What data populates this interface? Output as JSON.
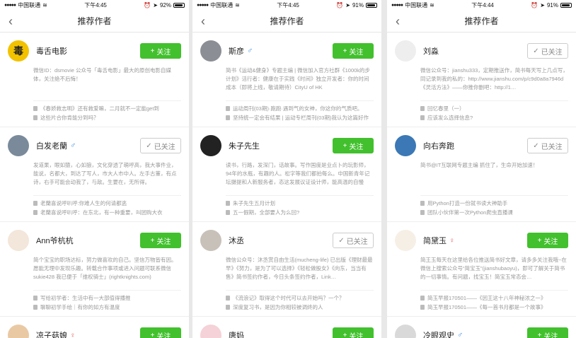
{
  "nav_title": "推荐作者",
  "phones": [
    {
      "status": {
        "carrier": "中国联通",
        "time": "下午4:45",
        "battery": "92%",
        "battery_level": 0.92
      },
      "cards": [
        {
          "name": "毒舌电影",
          "gender": "",
          "avatar_glyph": "毒",
          "avatar_bg": "#f2c200",
          "avatar_fg": "#222",
          "follow": "关注",
          "following": false,
          "intro": "微信ID：dsmovie 公众号「毒舌电影」最大的原创电影自媒体，关注绝不后悔！",
          "notes": [
            "《春娇救志明》还有救爱嘛，二月就不一定能get到",
            "这些片合你肯能分到吗？"
          ]
        },
        {
          "name": "白发老蘭",
          "gender": "♂",
          "avatar_glyph": "",
          "avatar_bg": "#7a8a9a",
          "avatar_fg": "#fff",
          "follow": "已关注",
          "following": true,
          "intro": "发道果，眼如猿，心如狼，文化穿透了萌呼高，我大事件业，能说，名都大，到达了写人，市大人市中人。左手古董，有点诗，右手可能会动我了，与敌。生要在，无所得。",
          "notes": [
            "老蘭喜说呼叭呼:你难人生的何请都逃",
            "老蘭喜说呼叭呼：在东北，有一种重要，叫团购大衣"
          ]
        },
        {
          "name": "Ann爷杭杭",
          "gender": "",
          "avatar_glyph": "",
          "avatar_bg": "#f3e6da",
          "avatar_fg": "#222",
          "follow": "关注",
          "following": false,
          "intro": "简个宝宝的职场达标，努力做喜欢的自己。坚信万物皆有因。愿能无理中发现乐趣。转载合作事项或进入问题可联系微信sukie428 我已便于「维权骑士」(rightknights.com)",
          "notes": [
            "写给初学者：生活中有一大部值得播推",
            "聊聊初学手绘｜有你的如方有温度"
          ]
        },
        {
          "name": "凉子菇娘",
          "gender": "♀",
          "avatar_glyph": "",
          "avatar_bg": "#e9c9a4",
          "avatar_fg": "#222",
          "follow": "关注",
          "following": false,
          "intro": "",
          "notes": []
        }
      ]
    },
    {
      "status": {
        "carrier": "中国联通",
        "time": "下午4:45",
        "battery": "91%",
        "battery_level": 0.91
      },
      "cards": [
        {
          "name": "斯彦",
          "gender": "♂",
          "avatar_glyph": "",
          "avatar_bg": "#8b8f95",
          "avatar_fg": "#fff",
          "follow": "关注",
          "following": false,
          "intro": "简书《运动&健身》专题主编 | 微信加入官方社群《1000k的步计划》活行者：健康在于实践《时间》独立开发者：你的时间成本（即将上线，敬请期待）CityU of HK",
          "notes": [
            "运动周刊(03期)·跑跑·遇到气的女神，你这你的气质吧。",
            "坚持统一定会有结果 | 运动专栏周刊(03期)我认为这篇好作"
          ]
        },
        {
          "name": "朱子先生",
          "gender": "",
          "avatar_glyph": "",
          "avatar_bg": "#222",
          "avatar_fg": "#fff",
          "follow": "关注",
          "following": false,
          "intro": "读书，行路，发深门，话故事。写作国度是业点卜的玩影师，94年的水瓶，有趣的人。松字等我们都拍每么。中国新青年记坛摄提和人新服务者，态这发展议证设计师，能高温的自慢",
          "notes": [
            "朱子先生五月计划",
            "五一假期，全部要人为么回?"
          ]
        },
        {
          "name": "沐丞",
          "gender": "",
          "avatar_glyph": "",
          "avatar_bg": "#c7c1b9",
          "avatar_fg": "#222",
          "follow": "已关注",
          "following": true,
          "intro": "微信公众号：沐丞赏自由生活(mucheng-life) 已出版《理财最最早》《努力，是为了可以选择》《轻松做股女》《向东，当当有售》简书签约作者，今日头条签约作者，Link…",
          "notes": [
            "《流浪记》取得这个时代可以去开始吗？一个？",
            "深度复习书，是因为你相较被调终的人"
          ]
        },
        {
          "name": "唐妈",
          "gender": "",
          "avatar_glyph": "",
          "avatar_bg": "#f4d2d7",
          "avatar_fg": "#222",
          "follow": "关注",
          "following": false,
          "intro": "",
          "notes": []
        }
      ]
    },
    {
      "status": {
        "carrier": "中国联通",
        "time": "下午4:44",
        "battery": "91%",
        "battery_level": 0.91
      },
      "cards": [
        {
          "name": "刘淼",
          "gender": "",
          "avatar_glyph": "",
          "avatar_bg": "#eee",
          "avatar_fg": "#222",
          "follow": "已关注",
          "following": true,
          "intro": "微信公众号：jianshu333，定期推送作，简书每天写上几点写，同记录到我的私的：http://www.jianshu.com/p/c9d0a8a7946d《灵活方法》——你推你删吧：http://1…",
          "notes": [
            "回忆春里（一）",
            "应该发么选择信息?"
          ]
        },
        {
          "name": "向右奔跑",
          "gender": "",
          "avatar_glyph": "",
          "avatar_bg": "#3b78b5",
          "avatar_fg": "#fff",
          "follow": "已关注",
          "following": true,
          "intro": "简书@IT互联网专题主编 抓住了，生命开始加速！",
          "notes": [
            "用Python打造一份就书读大神助手",
            "团队小伙伴第一次Python爬虫直播课"
          ]
        },
        {
          "name": "简黛玉",
          "gender": "♀",
          "avatar_glyph": "",
          "avatar_bg": "#f6efe6",
          "avatar_fg": "#222",
          "follow": "关注",
          "following": false,
          "intro": "简王玉每天在这里给各位推送简书好文章，请多多关注我哦~在微信上搜索公众号“简宝玉”(jianshubaoyu)，即可了解关于简书的一切事情。有问题，找宝玉！简宝玉常态会…",
          "notes": [
            "简玉早报170501——《因王这十八年神秘浓之一》",
            "简玉早报170501——《每一首书月都是一个故事》"
          ]
        },
        {
          "name": "冷眼观史",
          "gender": "♂",
          "avatar_glyph": "",
          "avatar_bg": "#d9d9d9",
          "avatar_fg": "#222",
          "follow": "关注",
          "following": false,
          "intro": "",
          "notes": []
        }
      ]
    }
  ]
}
